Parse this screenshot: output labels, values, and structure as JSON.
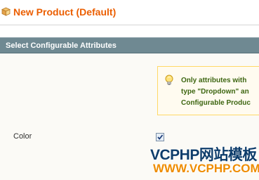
{
  "header": {
    "icon": "product-box-icon",
    "title": "New Product (Default)"
  },
  "section": {
    "title": "Select Configurable Attributes"
  },
  "notice": {
    "icon": "lightbulb-icon",
    "lines": [
      "Only attributes with",
      "type \"Dropdown\" an",
      "Configurable Produc"
    ]
  },
  "attribute": {
    "label": "Color",
    "checked": true
  },
  "watermark": {
    "line1": "VCPHP网站模板",
    "line2": "WWW.VCPHP.COM"
  },
  "colors": {
    "title": "#eb5e00",
    "section_bar": "#6f8992",
    "notice_bg": "#fffbf0",
    "notice_border": "#ffd967",
    "notice_text": "#3d6611"
  }
}
